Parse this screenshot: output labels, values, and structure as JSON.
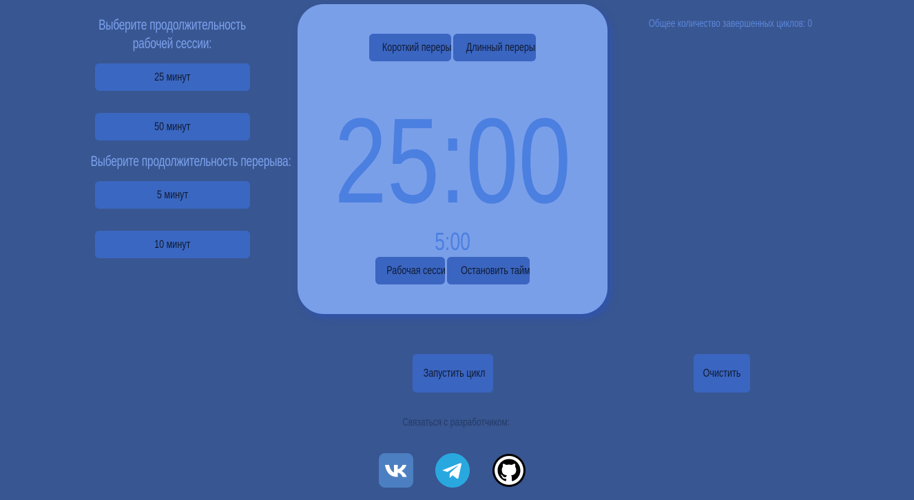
{
  "work_section": {
    "title": "Выберите продолжительность рабочей сессии:",
    "options": [
      "25 минут",
      "50 минут"
    ]
  },
  "break_section": {
    "title": "Выберите продолжительность перерыва:",
    "options": [
      "5 минут",
      "10 минут"
    ]
  },
  "timer": {
    "short_break_label": "Короткий перерыв",
    "long_break_label": "Длинный перерыв",
    "main_time": "25:00",
    "sub_time": "5:00",
    "work_session_label": "Рабочая сессия",
    "stop_timer_label": "Остановить таймер"
  },
  "cycles": {
    "text": "Общее количество завершенных циклов: 0"
  },
  "actions": {
    "start_cycle_label": "Запустить цикл",
    "clear_label": "Очистить"
  },
  "footer": {
    "contact_text": "Связаться с разработчиком:",
    "socials": [
      {
        "name": "vk-icon",
        "label": "VK"
      },
      {
        "name": "telegram-icon"
      },
      {
        "name": "github-icon"
      }
    ]
  },
  "colors": {
    "background": "#385691",
    "card": "#7a9fe9",
    "button": "#3a67c1",
    "accent_text": "#7ba1ee",
    "timer_text": "#4b7fe0"
  }
}
